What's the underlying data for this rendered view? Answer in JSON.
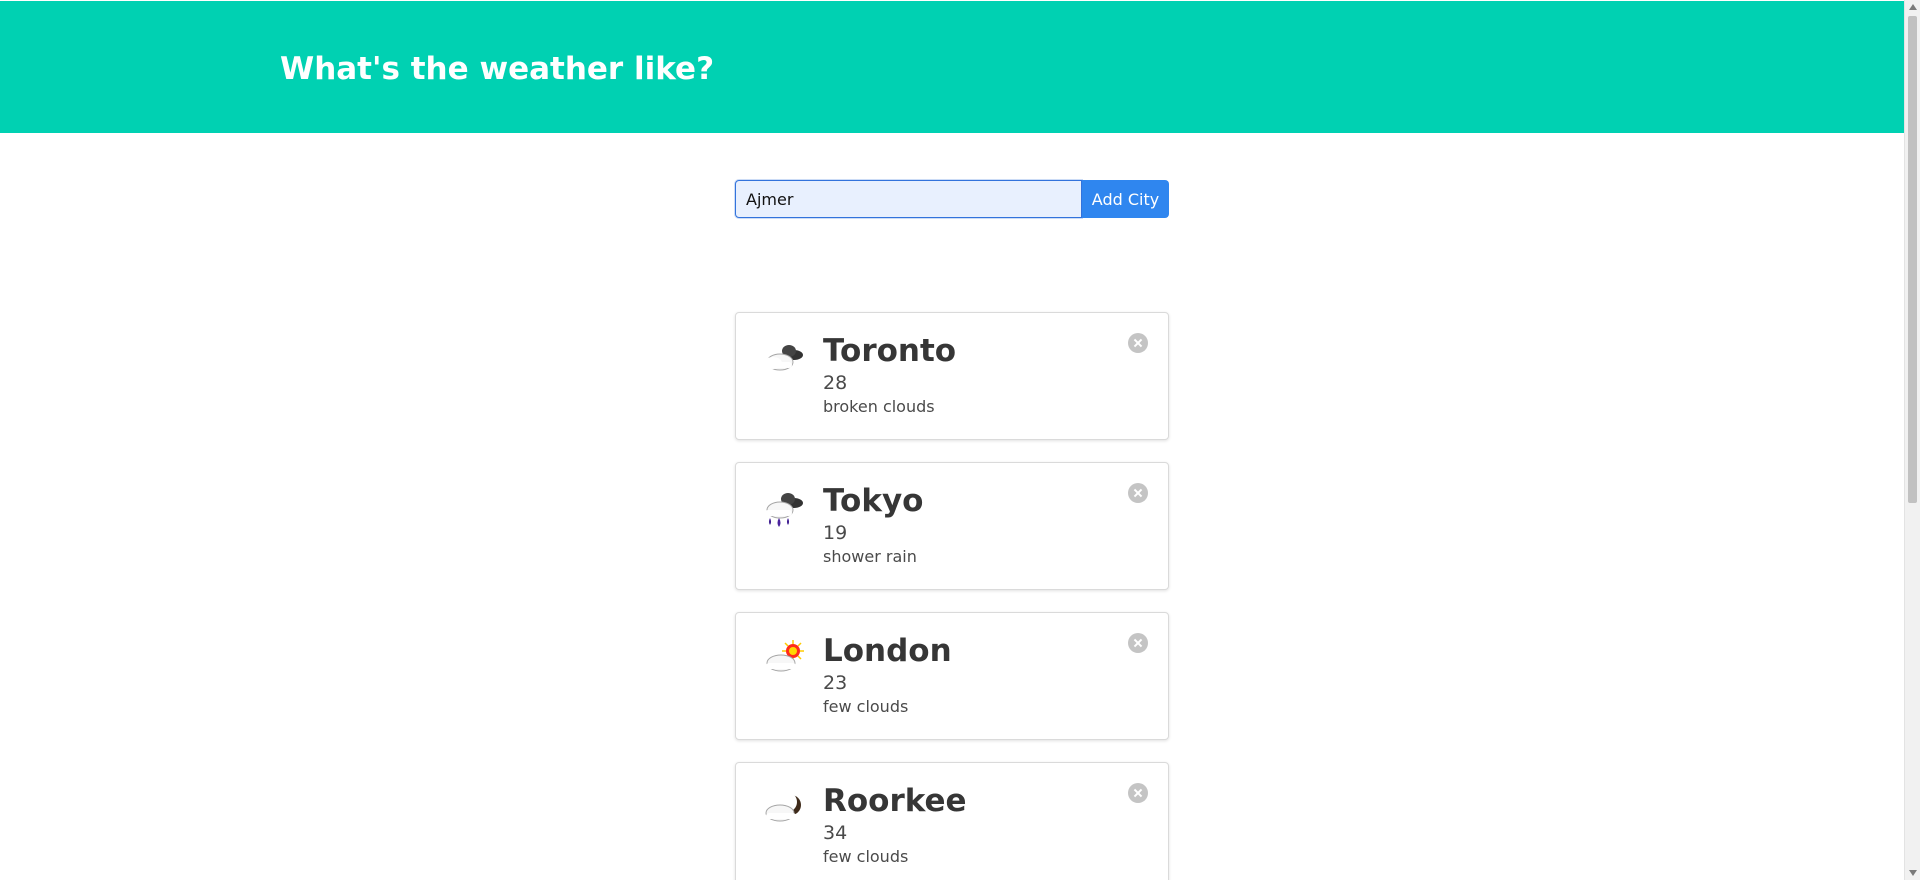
{
  "header": {
    "title": "What's the weather like?"
  },
  "search": {
    "value": "Ajmer",
    "button_label": "Add City"
  },
  "cities": [
    {
      "name": "Toronto",
      "temperature": "28",
      "description": "broken clouds",
      "icon": "broken-clouds-icon"
    },
    {
      "name": "Tokyo",
      "temperature": "19",
      "description": "shower rain",
      "icon": "shower-rain-icon"
    },
    {
      "name": "London",
      "temperature": "23",
      "description": "few clouds",
      "icon": "few-clouds-day-icon"
    },
    {
      "name": "Roorkee",
      "temperature": "34",
      "description": "few clouds",
      "icon": "few-clouds-night-icon"
    }
  ],
  "colors": {
    "header_background": "#00d1b2",
    "button_background": "#2f86ef",
    "input_background": "#e8f0fe",
    "remove_icon": "#c4c4c4",
    "text": "#363636"
  }
}
